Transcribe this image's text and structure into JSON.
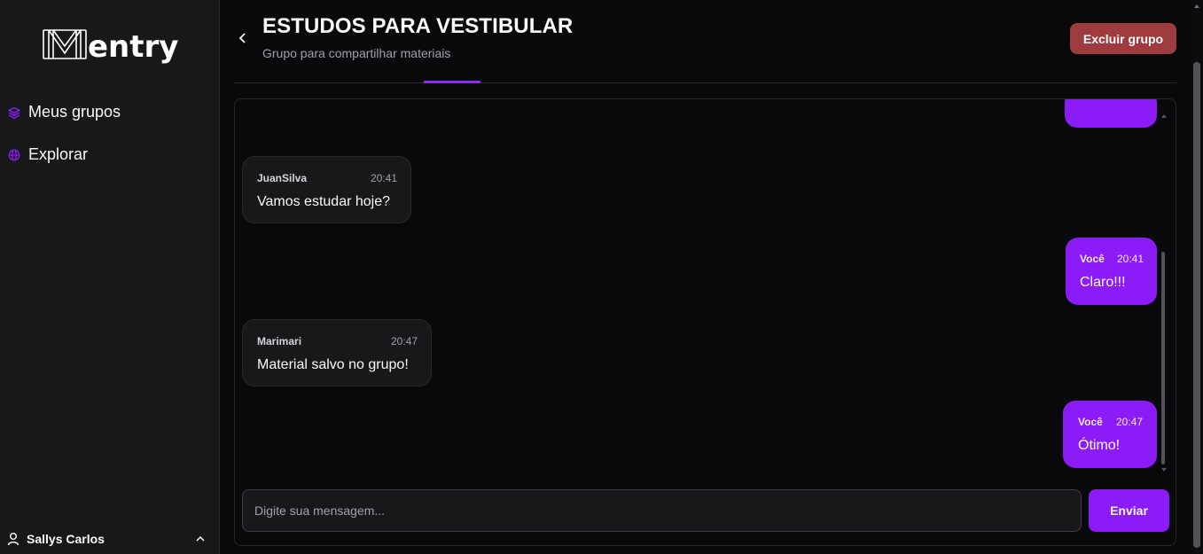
{
  "app": {
    "logo_text": "entry",
    "logo_letter": "M"
  },
  "sidebar": {
    "items": [
      {
        "label": "Meus grupos",
        "icon": "stack-icon"
      },
      {
        "label": "Explorar",
        "icon": "globe-icon"
      }
    ],
    "user": {
      "name": "Sallys Carlos",
      "icon": "user-icon"
    }
  },
  "header": {
    "title": "ESTUDOS PARA VESTIBULAR",
    "subtitle": "Grupo para compartilhar materiais",
    "delete_label": "Excluir grupo"
  },
  "chat": {
    "messages": [
      {
        "author": "JuanSilva",
        "time": "20:41",
        "text": "Vamos estudar hoje?",
        "mine": false
      },
      {
        "author": "Você",
        "time": "20:41",
        "text": "Claro!!!",
        "mine": true
      },
      {
        "author": "Marimari",
        "time": "20:47",
        "text": "Material salvo no grupo!",
        "mine": false
      },
      {
        "author": "Você",
        "time": "20:47",
        "text": "Ótimo!",
        "mine": true
      }
    ],
    "input_placeholder": "Digite sua mensagem...",
    "send_label": "Enviar"
  },
  "colors": {
    "accent": "#8b1cf7",
    "danger": "#9e3b3f",
    "background": "#09090b",
    "sidebar": "#18181b"
  }
}
